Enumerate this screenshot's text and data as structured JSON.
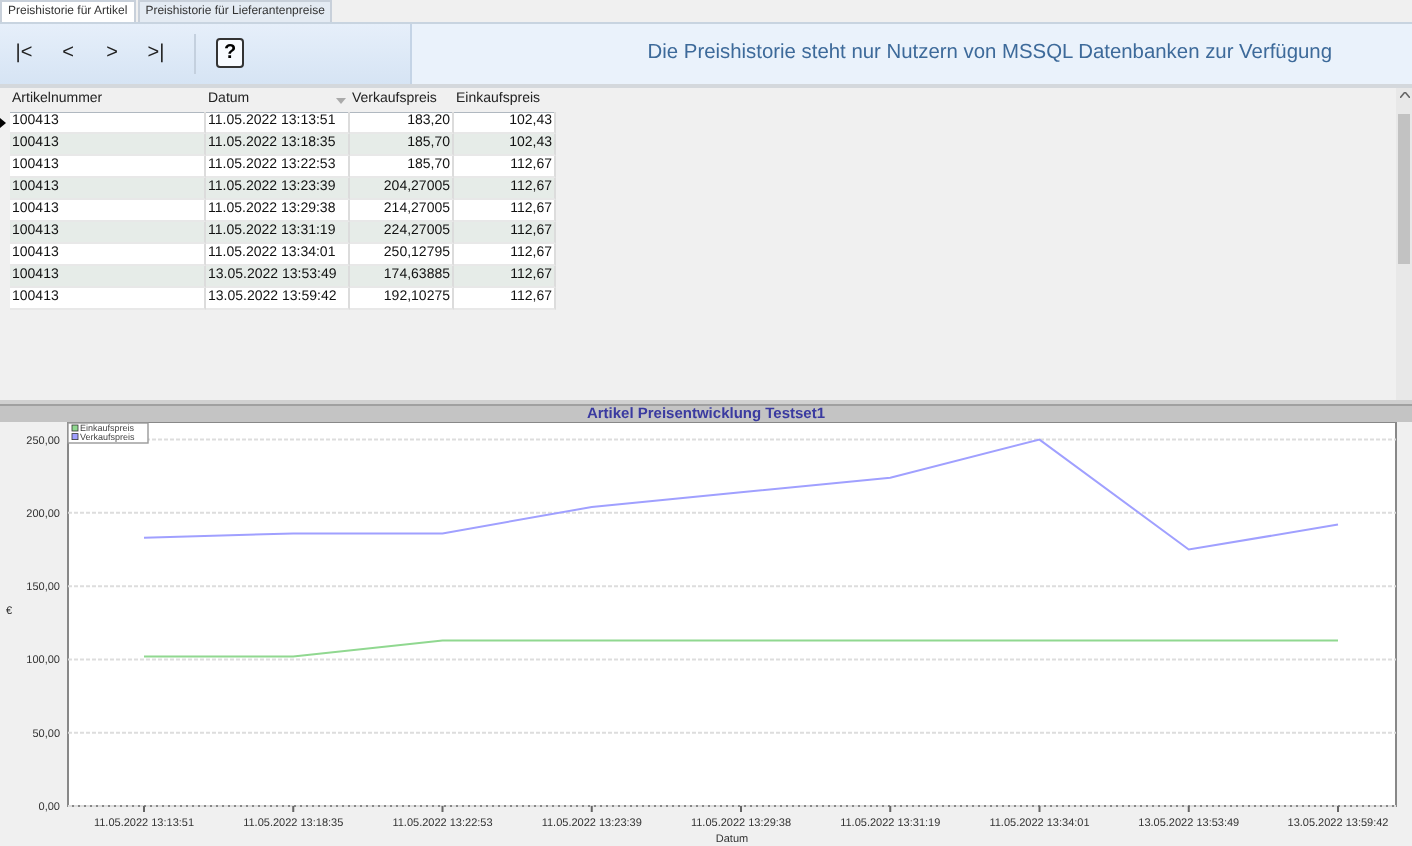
{
  "tabs": [
    {
      "label": "Preishistorie für Artikel",
      "selected": true
    },
    {
      "label": "Preishistorie für Lieferantenpreise",
      "selected": false
    }
  ],
  "toolbar": {
    "buttons": [
      {
        "label": "|<",
        "kind": "nav"
      },
      {
        "label": "<",
        "kind": "nav"
      },
      {
        "label": ">",
        "kind": "nav"
      },
      {
        "label": ">|",
        "kind": "nav"
      },
      {
        "label": "?",
        "kind": "help"
      }
    ],
    "message": "Die Preishistorie steht nur Nutzern von MSSQL Datenbanken zur Verfügung"
  },
  "table": {
    "columns": [
      {
        "label": "Artikelnummer",
        "sorted": false
      },
      {
        "label": "Datum",
        "sorted": true
      },
      {
        "label": "Verkaufspreis",
        "sorted": false
      },
      {
        "label": "Einkaufspreis",
        "sorted": false
      }
    ],
    "rows": [
      {
        "selected": true,
        "cells": [
          "100413",
          "11.05.2022 13:13:51",
          "183,20",
          "102,43"
        ]
      },
      {
        "selected": false,
        "cells": [
          "100413",
          "11.05.2022 13:18:35",
          "185,70",
          "102,43"
        ]
      },
      {
        "selected": false,
        "cells": [
          "100413",
          "11.05.2022 13:22:53",
          "185,70",
          "112,67"
        ]
      },
      {
        "selected": false,
        "cells": [
          "100413",
          "11.05.2022 13:23:39",
          "204,27005",
          "112,67"
        ]
      },
      {
        "selected": false,
        "cells": [
          "100413",
          "11.05.2022 13:29:38",
          "214,27005",
          "112,67"
        ]
      },
      {
        "selected": false,
        "cells": [
          "100413",
          "11.05.2022 13:31:19",
          "224,27005",
          "112,67"
        ]
      },
      {
        "selected": false,
        "cells": [
          "100413",
          "11.05.2022 13:34:01",
          "250,12795",
          "112,67"
        ]
      },
      {
        "selected": false,
        "cells": [
          "100413",
          "13.05.2022 13:53:49",
          "174,63885",
          "112,67"
        ]
      },
      {
        "selected": false,
        "cells": [
          "100413",
          "13.05.2022 13:59:42",
          "192,10275",
          "112,67"
        ]
      }
    ]
  },
  "chart": {
    "chart_data": {
      "type": "line",
      "title": "Artikel Preisentwicklung Testset1",
      "xlabel": "Datum",
      "ylabel": "€",
      "categories": [
        "11.05.2022 13:13:51",
        "11.05.2022 13:18:35",
        "11.05.2022 13:22:53",
        "11.05.2022 13:23:39",
        "11.05.2022 13:29:38",
        "11.05.2022 13:31:19",
        "11.05.2022 13:34:01",
        "13.05.2022 13:53:49",
        "13.05.2022 13:59:42"
      ],
      "series": [
        {
          "name": "Einkaufspreis",
          "color": "#90d890",
          "values": [
            102,
            102,
            113,
            113,
            113,
            113,
            113,
            113,
            113
          ]
        },
        {
          "name": "Verkaufspreis",
          "color": "#a0a0ff",
          "values": [
            183,
            186,
            186,
            204,
            214,
            224,
            250,
            175,
            192
          ]
        }
      ],
      "grid": true,
      "legend": true,
      "ylim": [
        0,
        262
      ],
      "yticks": [
        {
          "value": 0,
          "label": "0,00"
        },
        {
          "value": 50,
          "label": "50,00"
        },
        {
          "value": 100,
          "label": "100,00"
        },
        {
          "value": 150,
          "label": "150,00"
        },
        {
          "value": 200,
          "label": "200,00"
        },
        {
          "value": 250,
          "label": "250,00"
        }
      ]
    }
  }
}
